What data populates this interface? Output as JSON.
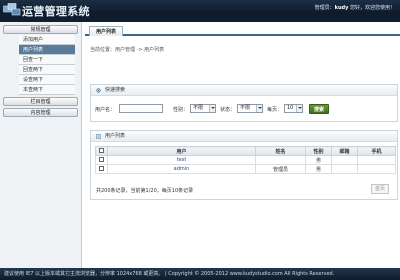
{
  "header": {
    "title": "运营管理系统",
    "welcome_prefix": "管理员：",
    "username": "kudy",
    "welcome_suffix": " 您好，欢迎您使用！"
  },
  "sidebar": {
    "groups": [
      {
        "title": "常规管理",
        "items": [
          "添加用户",
          "用户列表",
          "回查一下",
          "回查两下",
          "设查两下",
          "本查两下"
        ]
      },
      {
        "title": "栏目管理"
      },
      {
        "title": "内容管理"
      }
    ]
  },
  "tab": {
    "label": "用户列表"
  },
  "breadcrumb": "当前位置：用户管理 -> 用户列表",
  "search": {
    "panel_title": "快速搜索",
    "username_label": "用户名：",
    "gender_label": "性别：",
    "gender_value": "不限",
    "status_label": "状态：",
    "status_value": "不限",
    "perpage_label": "每页：",
    "perpage_value": "10",
    "button": "搜索"
  },
  "list": {
    "panel_title": "用户列表",
    "columns": [
      "",
      "用户",
      "姓名",
      "性别",
      "邮箱",
      "手机"
    ],
    "rows": [
      {
        "user": "test",
        "name": "",
        "gender": "男",
        "email": "",
        "phone": ""
      },
      {
        "user": "admin",
        "name": "管理员",
        "gender": "男",
        "email": "",
        "phone": ""
      }
    ],
    "pager_text": "共200条记录，当前第1/20，每页10条记录",
    "first_page": "首页"
  },
  "footer": "建议使用 IE7 以上版本或其它主流浏览器，分辨率 1024x768 或更高。 | Copyright © 2005-2012 www.kudystudio.com All Rights Reserved.",
  "colors": {
    "header": "#132334",
    "accent": "#3d6487",
    "search_button": "#5a8a2c"
  }
}
